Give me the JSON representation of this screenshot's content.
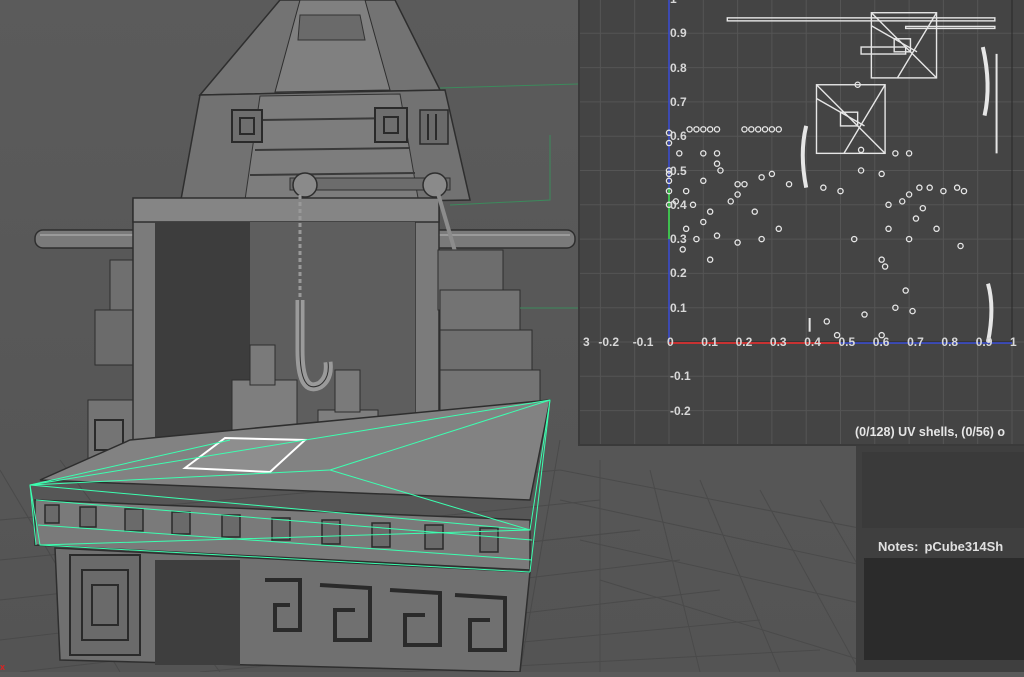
{
  "uv_editor": {
    "v_ticks": [
      "1",
      "0.9",
      "0.8",
      "0.7",
      "0.6",
      "0.5",
      "0.4",
      "0.3",
      "0.2",
      "0.1",
      "-0.1",
      "-0.2"
    ],
    "u_ticks": [
      "3",
      "-0.2",
      "-0.1",
      "0",
      "0.1",
      "0.2",
      "0.3",
      "0.4",
      "0.5",
      "0.6",
      "0.7",
      "0.8",
      "0.9",
      "1"
    ],
    "status": "(0/128) UV shells, (0/56) o"
  },
  "attribute_panel": {
    "notes_label": "Notes:",
    "notes_object": "pCube314Sh"
  },
  "colors": {
    "viewport_bg": "#5a5a5a",
    "uv_bg": "#444444",
    "selection_wire": "#3cffb0",
    "u_axis": "#c83232",
    "v_axis": "#3b4ed8",
    "tick_text": "#d8d8d8"
  }
}
